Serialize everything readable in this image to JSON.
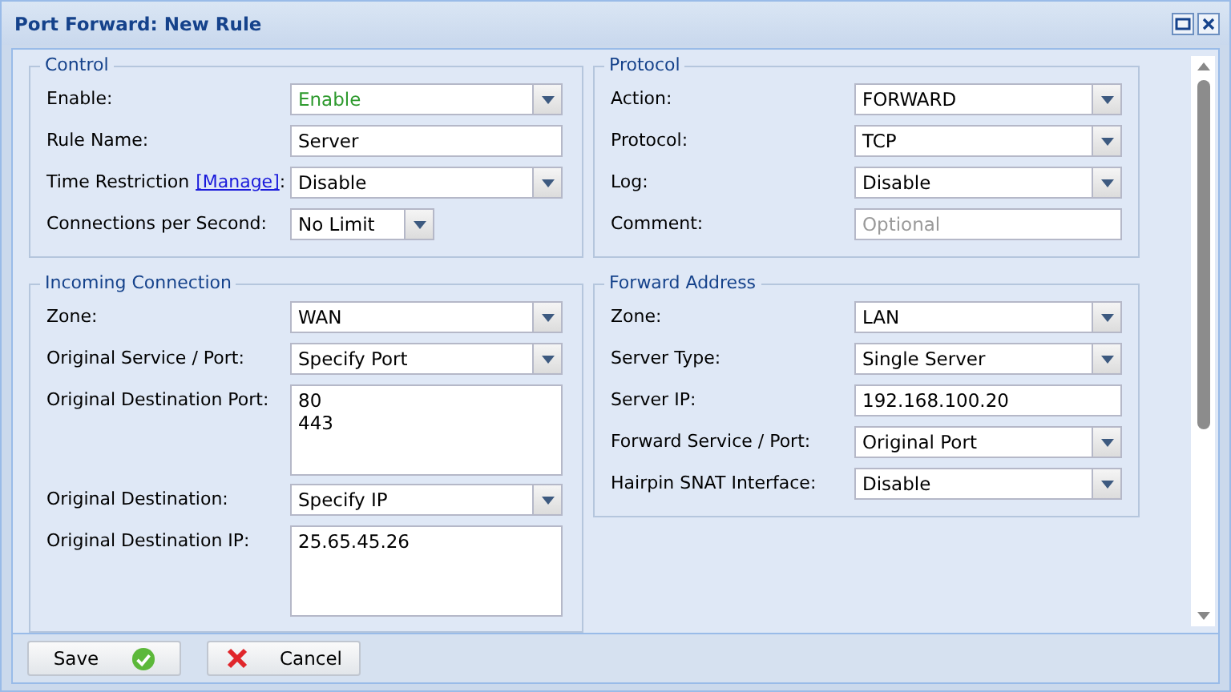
{
  "window": {
    "title": "Port Forward: New Rule"
  },
  "left_column": {
    "groups": [
      {
        "title": "Control",
        "rows": [
          {
            "label": "Enable:",
            "kind": "select",
            "value": "Enable",
            "color": "#2e9a2e"
          },
          {
            "label": "Rule Name:",
            "kind": "text",
            "value": "Server"
          },
          {
            "label": "Time Restriction",
            "link": "[Manage]",
            "suffix": ":",
            "kind": "select",
            "value": "Disable"
          },
          {
            "label": "Connections per Second:",
            "kind": "short-select",
            "value": "No Limit"
          }
        ]
      },
      {
        "title": "Incoming Connection",
        "rows": [
          {
            "label": "Zone:",
            "kind": "select",
            "value": "WAN"
          },
          {
            "label": "Original Service / Port:",
            "kind": "select",
            "value": "Specify Port"
          },
          {
            "label": "Original Destination Port:",
            "kind": "textarea",
            "value": "80\n443"
          },
          {
            "label": "Original Destination:",
            "kind": "select",
            "value": "Specify IP"
          },
          {
            "label": "Original Destination IP:",
            "kind": "textarea",
            "value": "25.65.45.26"
          }
        ]
      }
    ]
  },
  "right_column": {
    "groups": [
      {
        "title": "Protocol",
        "rows": [
          {
            "label": "Action:",
            "kind": "select",
            "value": "FORWARD"
          },
          {
            "label": "Protocol:",
            "kind": "select",
            "value": "TCP"
          },
          {
            "label": "Log:",
            "kind": "select",
            "value": "Disable"
          },
          {
            "label": "Comment:",
            "kind": "text",
            "placeholder": "Optional"
          }
        ]
      },
      {
        "title": "Forward Address",
        "rows": [
          {
            "label": "Zone:",
            "kind": "select",
            "value": "LAN"
          },
          {
            "label": "Server Type:",
            "kind": "select",
            "value": "Single Server"
          },
          {
            "label": "Server IP:",
            "kind": "text",
            "value": "192.168.100.20"
          },
          {
            "label": "Forward Service / Port:",
            "kind": "select",
            "value": "Original Port"
          },
          {
            "label": "Hairpin SNAT Interface:",
            "kind": "select",
            "value": "Disable"
          }
        ]
      }
    ]
  },
  "buttons": [
    {
      "label": "Save",
      "kind": "save"
    },
    {
      "label": "Cancel",
      "kind": "cancel"
    }
  ]
}
